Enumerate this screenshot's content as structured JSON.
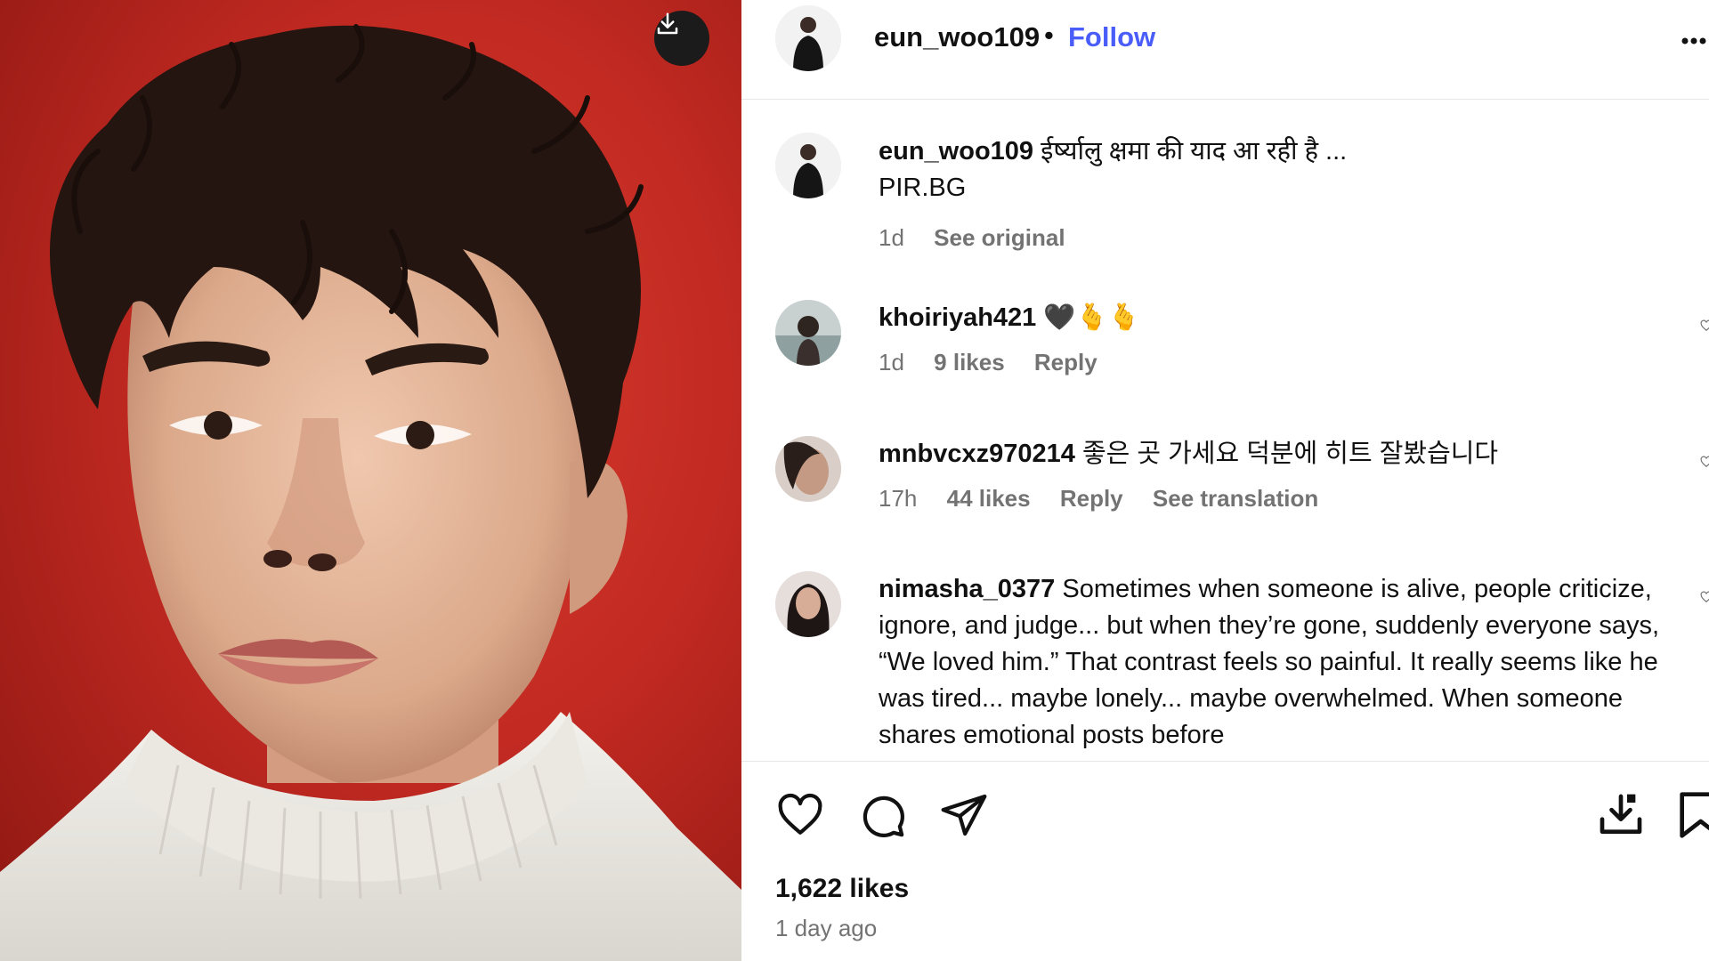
{
  "post": {
    "author": "eun_woo109",
    "follow_label": "Follow",
    "separator": "•",
    "likes": "1,622 likes",
    "time_ago": "1 day ago"
  },
  "caption": {
    "user": "eun_woo109",
    "text_line1": "ईर्ष्यालु क्षमा की याद आ रही है ...",
    "text_line2": "PIR.BG",
    "time": "1d",
    "see_original": "See original"
  },
  "comments": [
    {
      "user": "khoiriyah421",
      "text": "🖤🫰🫰",
      "time": "1d",
      "likes": "9 likes",
      "reply": "Reply"
    },
    {
      "user": "mnbvcxz970214",
      "text": "좋은 곳 가세요 덕분에 히트 잘봤습니다",
      "time": "17h",
      "likes": "44 likes",
      "reply": "Reply",
      "see_translation": "See translation"
    },
    {
      "user": "nimasha_0377",
      "text": "Sometimes when someone is alive, people criticize, ignore, and judge... but when they’re gone, suddenly everyone says, “We loved him.” That contrast feels so painful. It really seems like he was tired... maybe lonely... maybe overwhelmed. When someone shares emotional posts before"
    }
  ],
  "icons": {
    "download": "download-icon",
    "more": "more-options-icon",
    "like": "heart-icon",
    "comment": "comment-icon",
    "share": "share-icon",
    "save_download": "download-tray-icon",
    "bookmark": "bookmark-icon"
  },
  "colors": {
    "follow": "#4a5df9",
    "muted_text": "#737373",
    "divider": "#e6e6e6",
    "photo_background": "#c22a22"
  }
}
